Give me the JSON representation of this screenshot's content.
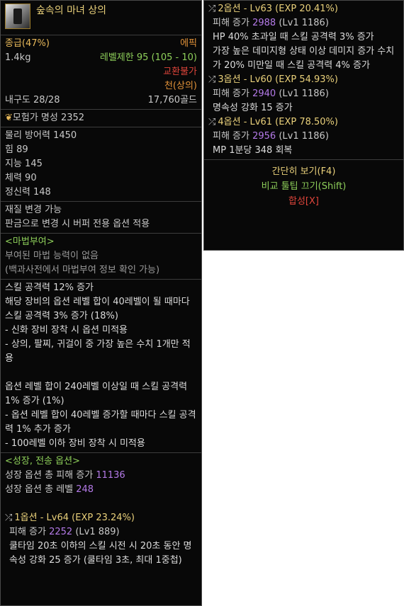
{
  "item": {
    "name": "숲속의 마녀 상의",
    "grade": "종급(47%)",
    "rarity": "에픽",
    "weight": "1.4kg",
    "level_limit": "레벨제한 95 (105 - 10)",
    "trade": "교환불가",
    "material": "천(상의)",
    "durability": "내구도 28/28",
    "price": "17,760골드",
    "adventurer_fame": "모험가 명성 2352"
  },
  "stats": [
    "물리 방어력 1450",
    "힘 89",
    "지능 145",
    "체력 90",
    "정신력 148"
  ],
  "material_change": [
    "재질 변경 가능",
    "판금으로 변경 시 버퍼 전용 옵션 적용"
  ],
  "enchant": {
    "header": "<마법부여>",
    "none": "부여된 마법 능력이 없음",
    "hint": "(백과사전에서 마법부여 정보 확인 가능)"
  },
  "options_text": [
    "스킬 공격력 12% 증가",
    "해당 장비의 옵션 레벨 합이 40레벨이 될 때마다 스킬 공격력 3% 증가 (18%)",
    "- 신화 장비 장착 시 옵션 미적용",
    "- 상의, 팔찌, 귀걸이 중 가장 높은 수치 1개만 적용",
    "옵션 레벨 합이 240레벨 이상일 때 스킬 공격력 1% 증가 (1%)",
    "- 옵션 레벨 합이 40레벨 증가할 때마다 스킬 공격력 1% 추가 증가",
    "- 100레벨 이하 장비 장착 시 미적용"
  ],
  "growth": {
    "header": "<성장, 전송 옵션>",
    "total_damage_label": "성장 옵션 총 피해 증가 ",
    "total_damage_value": "11136",
    "total_level_label": "성장 옵션 총 레벨 ",
    "total_level_value": "248"
  },
  "growth_options": [
    {
      "title": "1옵션 - Lv64 (EXP 23.24%)",
      "damage_label": "피해 증가 ",
      "damage_value": "2252",
      "damage_base": " (Lv1 889)",
      "desc": "쿨타임 20초 이하의 스킬 시전 시 20초 동안 명속성 강화 25 증가 (쿨타임 3초, 최대 1중첩)"
    },
    {
      "title": "2옵션 - Lv63 (EXP 20.41%)",
      "damage_label": "피해 증가 ",
      "damage_value": "2988",
      "damage_base": " (Lv1 1186)",
      "desc": "HP 40% 초과일 때 스킬 공격력 3% 증가",
      "desc2": "가장 높은 데미지형 상태 이상 데미지 증가 수치가 20% 미만일 때 스킬 공격력 4% 증가"
    },
    {
      "title": "3옵션 - Lv60 (EXP 54.93%)",
      "damage_label": "피해 증가 ",
      "damage_value": "2940",
      "damage_base": " (Lv1 1186)",
      "desc": "명속성 강화 15 증가"
    },
    {
      "title": "4옵션 - Lv61 (EXP 78.50%)",
      "damage_label": "피해 증가 ",
      "damage_value": "2956",
      "damage_base": " (Lv1 1186)",
      "desc": "MP 1분당 348 회복"
    }
  ],
  "footer": {
    "brief": "간단히 보기(F4)",
    "compare": "비교 툴팁 끄기(Shift)",
    "synth": "합성[X]"
  },
  "icons": {
    "shuffle": "shuffle-icon",
    "fame": "fame-icon"
  }
}
